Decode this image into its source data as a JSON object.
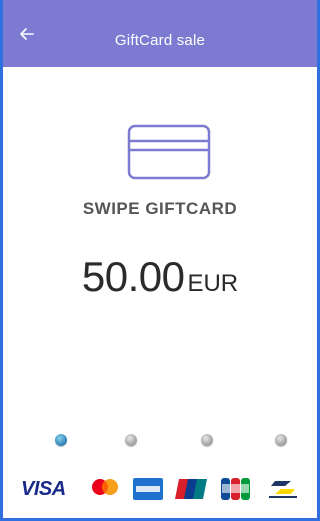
{
  "header": {
    "title": "GiftCard sale",
    "back_icon": "arrow-left-icon",
    "color": "#7c7bd1"
  },
  "main": {
    "card_icon": "credit-card-icon",
    "instruction": "SWIPE GIFTCARD",
    "amount": "50.00",
    "currency": "EUR"
  },
  "pager": {
    "count": 4,
    "active_index": 0
  },
  "payment_brands": [
    {
      "name": "VISA",
      "icon": "visa-logo"
    },
    {
      "name": "mastercard",
      "icon": "mastercard-logo"
    },
    {
      "name": "American Express",
      "icon": "amex-logo"
    },
    {
      "name": "UnionPay",
      "icon": "unionpay-logo"
    },
    {
      "name": "JCB",
      "icon": "jcb-logo"
    },
    {
      "name": "Bancontact",
      "icon": "bancontact-logo"
    }
  ],
  "colors": {
    "accent": "#7c7bd1",
    "frame": "#2f6fe0",
    "active_dot": "#2b7fb3",
    "inactive_dot": "#9c9c9c"
  }
}
